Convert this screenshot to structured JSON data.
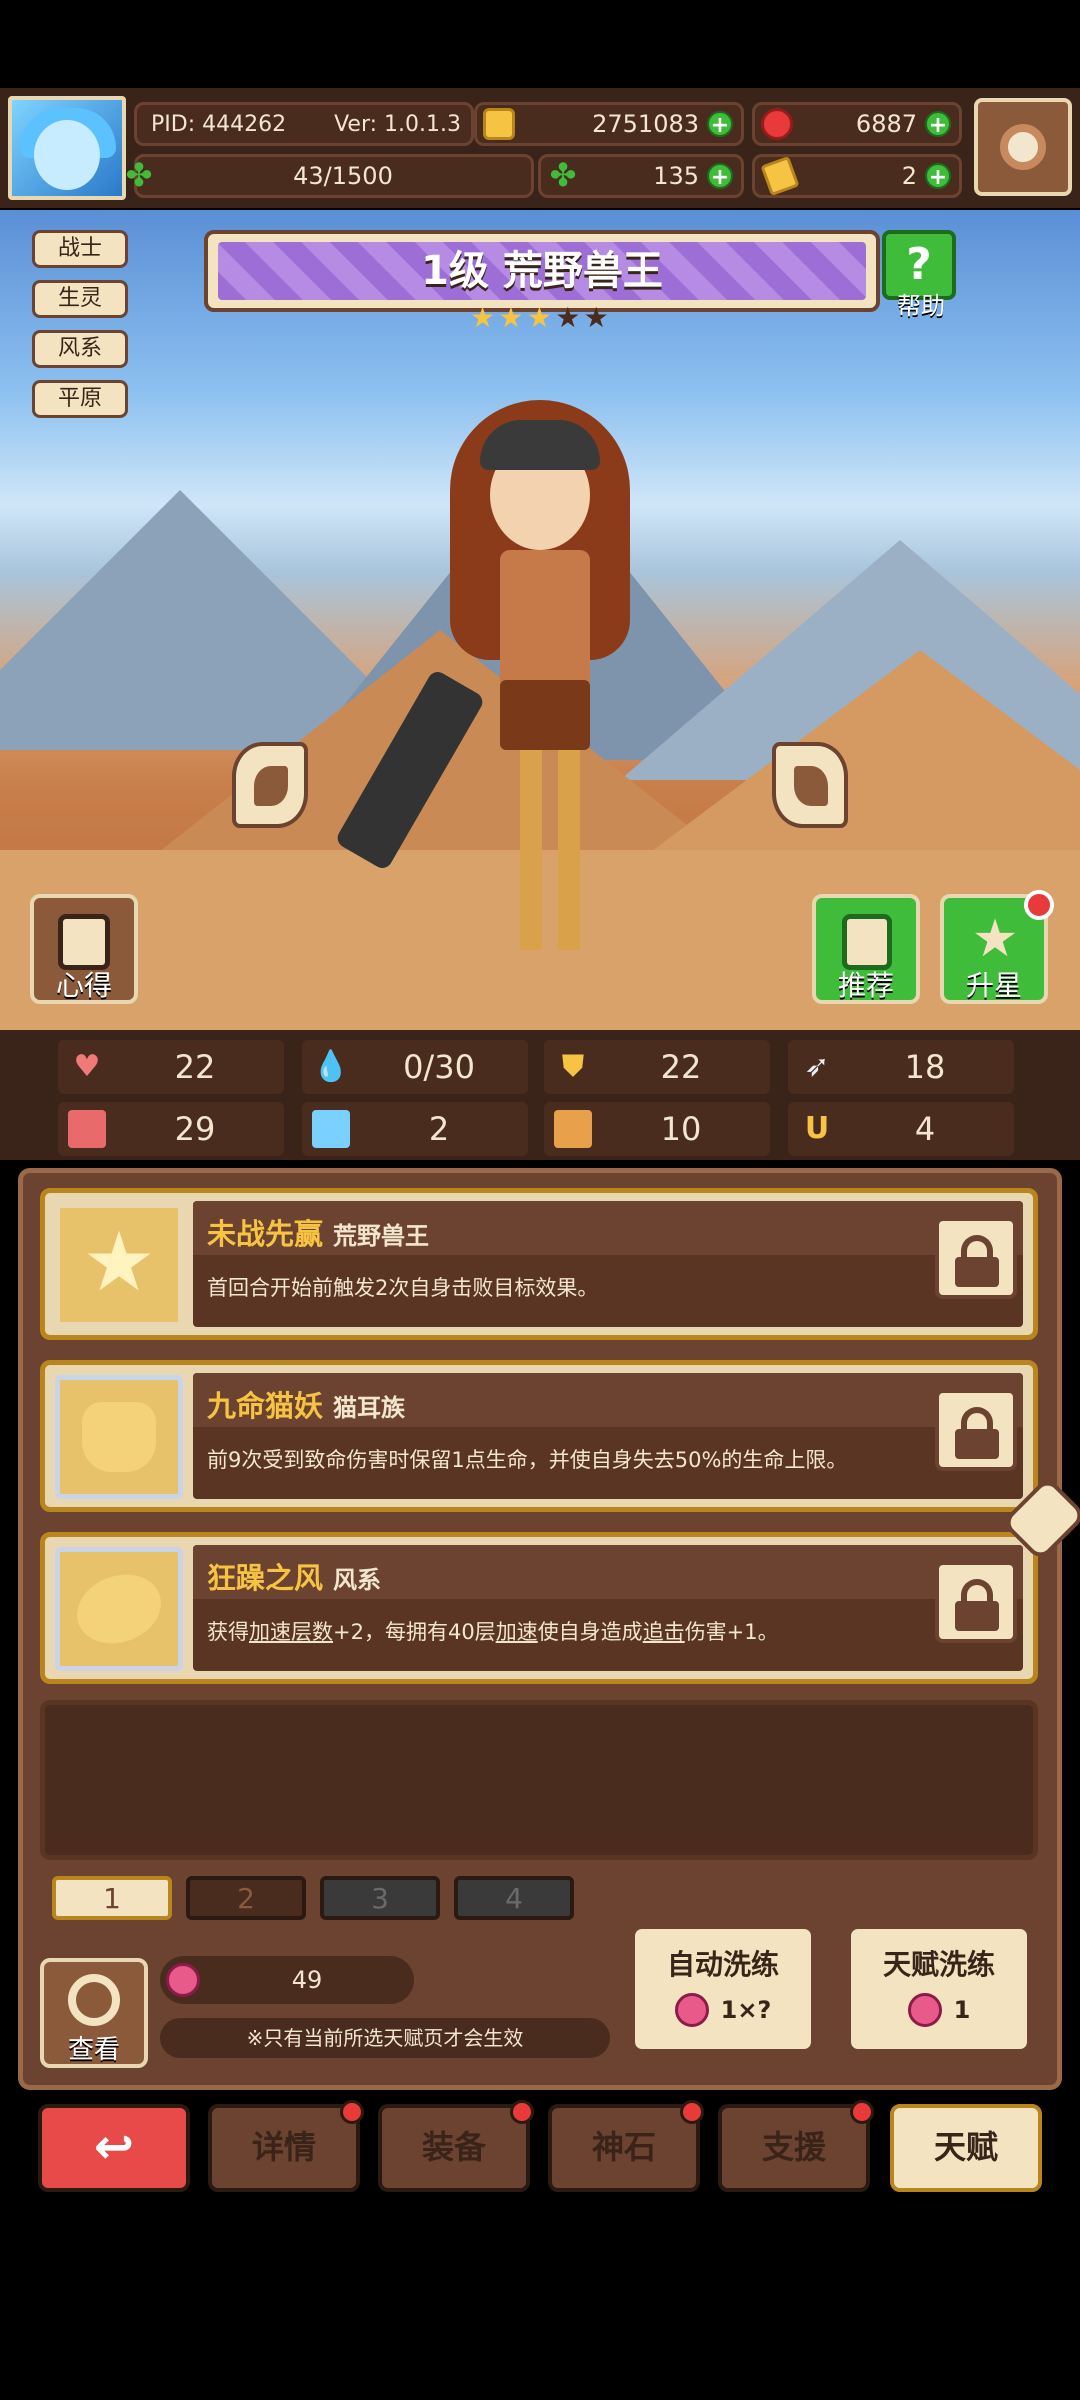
{
  "header": {
    "pid": "PID: 444262",
    "version": "Ver: 1.0.1.3",
    "gold": "2751083",
    "gems": "6887",
    "energy": "43/1500",
    "clover": "135",
    "tickets": "2"
  },
  "tags": [
    "战士",
    "生灵",
    "风系",
    "平原"
  ],
  "hero": {
    "title": "1级  荒野兽王",
    "stars_filled": 3,
    "stars_total": 5,
    "help_label": "帮助"
  },
  "side_buttons": {
    "insight": "心得",
    "recommend": "推荐",
    "star_up": "升星"
  },
  "stats": {
    "health": "22",
    "mana": "0/30",
    "defense": "22",
    "speed": "18",
    "attack": "29",
    "magic": "2",
    "agility": "10",
    "luck": "4"
  },
  "talents": [
    {
      "name": "未战先赢",
      "source": "荒野兽王",
      "description": "首回合开始前触发2次自身击败目标效果。"
    },
    {
      "name": "九命猫妖",
      "source": "猫耳族",
      "description": "前9次受到致命伤害时保留1点生命，并使自身失去50%的生命上限。"
    },
    {
      "name": "狂躁之风",
      "source": "风系",
      "desc_parts": [
        "获得",
        "加速层数",
        "+2，每拥有40层",
        "加速",
        "使自身造成",
        "追击",
        "伤害+1。"
      ]
    }
  ],
  "pages": [
    "1",
    "2",
    "3",
    "4"
  ],
  "reroll": {
    "resource_count": "49",
    "note": "※只有当前所选天赋页才会生效",
    "view_label": "查看",
    "auto_label": "自动洗练",
    "auto_cost": "1×?",
    "talent_label": "天赋洗练",
    "talent_cost": "1"
  },
  "nav": {
    "back_icon": "back-arrow-icon",
    "details": "详情",
    "equipment": "装备",
    "godstone": "神石",
    "support": "支援",
    "talent": "天赋"
  },
  "colors": {
    "panel": "#6b4330",
    "accent_gold": "#f6c342",
    "purple_banner": "#9d6fd6",
    "green_button": "#3fbd3a",
    "red_button": "#e84a4a"
  }
}
